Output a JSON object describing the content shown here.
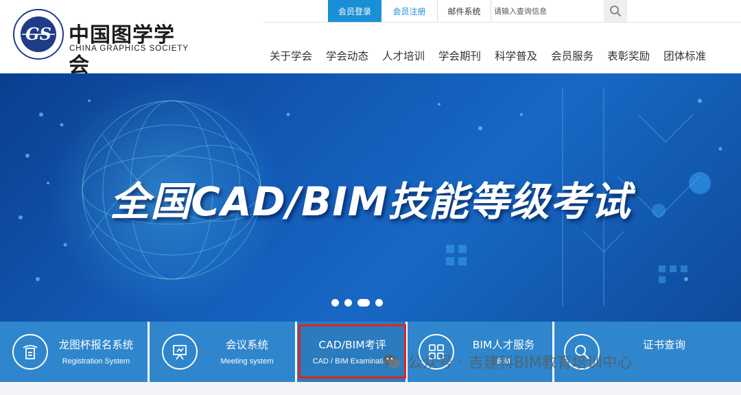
{
  "logo": {
    "cn_name": "中国图学学会",
    "en_name": "CHINA GRAPHICS SOCIETY",
    "emblem_text": "中国图学学会",
    "emblem_en": "CHINA GRAPHICS SOCIETY"
  },
  "topbar": {
    "login": "会员登录",
    "register": "会员注册",
    "mail": "邮件系统",
    "search_placeholder": "请输入查询信息"
  },
  "nav": [
    "关于学会",
    "学会动态",
    "人才培训",
    "学会期刊",
    "科学普及",
    "会员服务",
    "表彰奖励",
    "团体标准"
  ],
  "banner": {
    "title": "全国CAD/BIM技能等级考试",
    "slides": 4,
    "active_slide": 3
  },
  "services": [
    {
      "cn": "龙图杯报名系统",
      "en": "Registration System",
      "icon": "registration-icon"
    },
    {
      "cn": "会议系统",
      "en": "Meeting system",
      "icon": "meeting-icon"
    },
    {
      "cn": "CAD/BIM考评",
      "en": "CAD / BIM Examination",
      "icon": ""
    },
    {
      "cn": "BIM人才服务",
      "en": "BIM",
      "icon": "grid-icon"
    },
    {
      "cn": "证书查询",
      "en": "",
      "icon": "search-icon"
    }
  ],
  "watermark": {
    "prefix": "公众号",
    "separator": "·",
    "name": "吉建科BIM教育培训中心"
  },
  "colors": {
    "accent": "#1a8fd6",
    "banner": "#1258b4",
    "service_bar": "#2f86cc",
    "highlight": "#e3221c"
  }
}
